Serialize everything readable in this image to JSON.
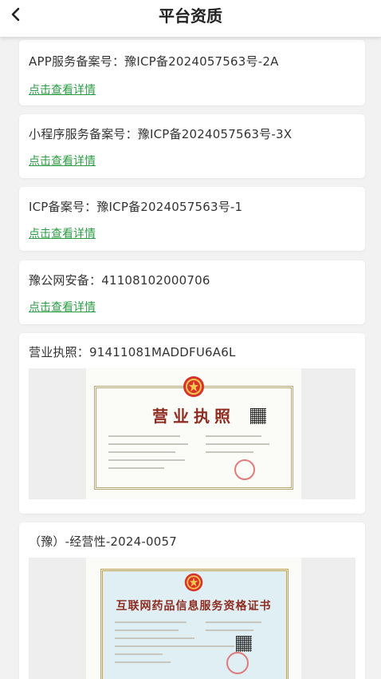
{
  "header": {
    "title": "平台资质",
    "back_icon": "chevron-left-icon"
  },
  "cards": [
    {
      "text": "APP服务备案号：豫ICP备2024057563号-2A",
      "link": "点击查看详情"
    },
    {
      "text": "小程序服务备案号：豫ICP备2024057563号-3X",
      "link": "点击查看详情"
    },
    {
      "text": "ICP备案号：豫ICP备2024057563号-1",
      "link": "点击查看详情"
    },
    {
      "text": "豫公网安备：41108102000706",
      "link": "点击查看详情"
    }
  ],
  "license": {
    "text": "营业执照：91411081MADDFU6A6L",
    "certificate_title": "营业执照"
  },
  "drug_cert": {
    "text": "（豫）-经营性-2024-0057",
    "certificate_title": "互联网药品信息服务资格证书"
  },
  "colors": {
    "link": "#2e9c45",
    "background": "#f2f2f2",
    "card": "#ffffff",
    "license_bg": "#fbfbf7",
    "drug_bg": "#dfeff3"
  }
}
